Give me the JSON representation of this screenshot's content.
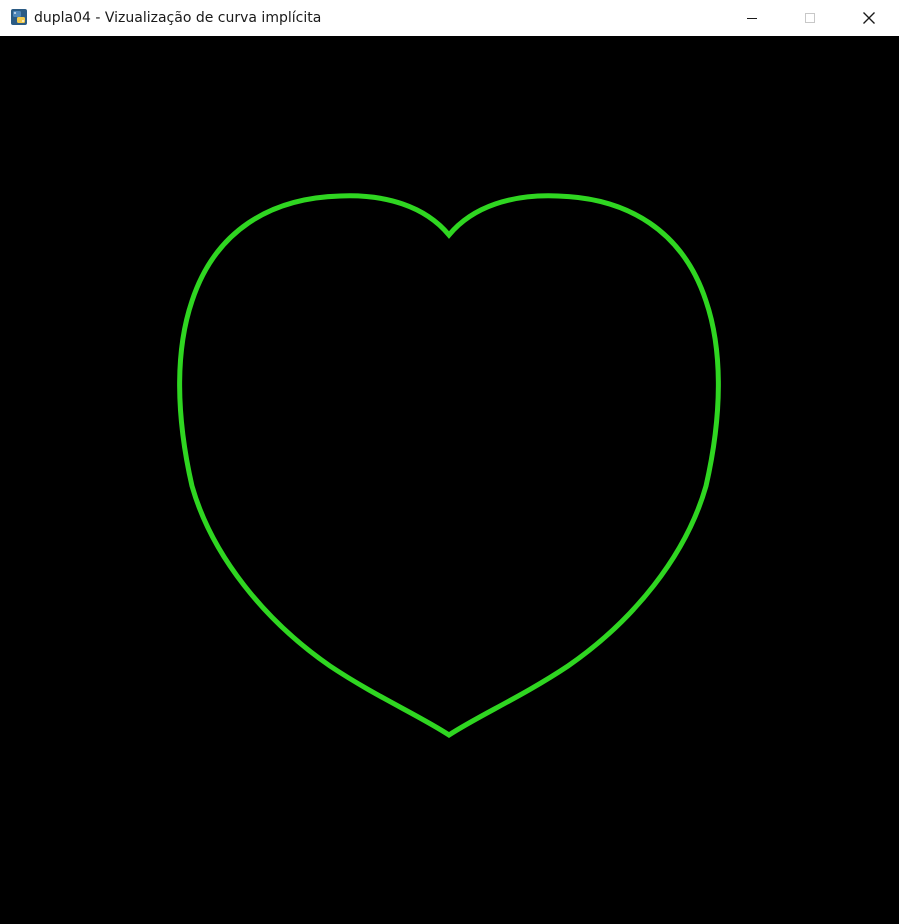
{
  "window": {
    "title": "dupla04 - Vizualização de curva implícita",
    "app_icon": "python-icon",
    "controls": {
      "minimize_icon": "minimize-icon",
      "maximize_icon": "maximize-icon",
      "close_icon": "close-icon"
    }
  },
  "canvas": {
    "background_color": "#000000",
    "curve_color": "#2fd621",
    "curve_shape": "heart"
  }
}
